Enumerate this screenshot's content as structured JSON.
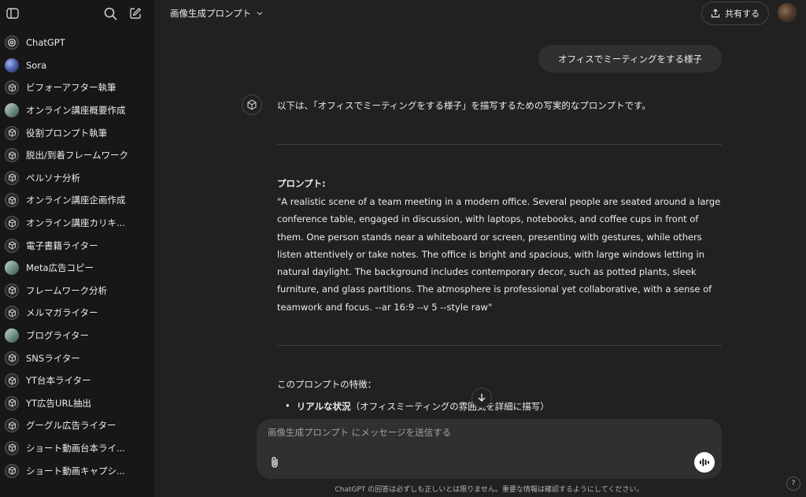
{
  "sidebar": {
    "items": [
      {
        "label": "ChatGPT",
        "icon": "chatgpt-logo-icon"
      },
      {
        "label": "Sora",
        "icon": "sora-avatar"
      },
      {
        "label": "ビフォーアフター執筆",
        "icon": "gpt-cube-icon"
      },
      {
        "label": "オンライン講座概要作成",
        "icon": "gpt-custom-avatar"
      },
      {
        "label": "役割プロンプト執筆",
        "icon": "gpt-cube-icon"
      },
      {
        "label": "脱出/到着フレームワーク",
        "icon": "gpt-cube-icon"
      },
      {
        "label": "ペルソナ分析",
        "icon": "gpt-cube-icon"
      },
      {
        "label": "オンライン講座企画作成",
        "icon": "gpt-cube-icon"
      },
      {
        "label": "オンライン講座カリキ...",
        "icon": "gpt-cube-icon"
      },
      {
        "label": "電子書籍ライター",
        "icon": "gpt-cube-icon"
      },
      {
        "label": "Meta広告コピー",
        "icon": "gpt-custom-avatar"
      },
      {
        "label": "フレームワーク分析",
        "icon": "gpt-cube-icon"
      },
      {
        "label": "メルマガライター",
        "icon": "gpt-cube-icon"
      },
      {
        "label": "ブログライター",
        "icon": "gpt-custom-avatar"
      },
      {
        "label": "SNSライター",
        "icon": "gpt-cube-icon"
      },
      {
        "label": "YT台本ライター",
        "icon": "gpt-cube-icon"
      },
      {
        "label": "YT広告URL抽出",
        "icon": "gpt-cube-icon"
      },
      {
        "label": "グーグル広告ライター",
        "icon": "gpt-cube-icon"
      },
      {
        "label": "ショート動画台本ライ...",
        "icon": "gpt-cube-icon"
      },
      {
        "label": "ショート動画キャプシ...",
        "icon": "gpt-cube-icon"
      }
    ]
  },
  "header": {
    "title": "画像生成プロンプト",
    "share_label": "共有する"
  },
  "chat": {
    "user_message": "オフィスでミーティングをする様子",
    "assistant": {
      "intro": "以下は、「オフィスでミーティングをする様子」を描写するための写実的なプロンプトです。",
      "prompt_heading": "プロンプト:",
      "prompt_lines": [
        "\"A realistic scene of a team meeting in a modern office. Several people are seated around a large",
        "conference table, engaged in discussion, with laptops, notebooks, and coffee cups in front of",
        "them. One person stands near a whiteboard or screen, presenting with gestures, while others",
        "listen attentively or take notes. The office is bright and spacious, with large windows letting in",
        "natural daylight. The background includes contemporary decor, such as potted plants, sleek",
        "furniture, and glass partitions. The atmosphere is professional yet collaborative, with a sense of",
        "teamwork and focus. --ar 16:9 --v 5 --style raw\""
      ],
      "features_heading": "このプロンプトの特徴：",
      "bullet_bold": "リアルな状況",
      "bullet_rest": "（オフィスミーティングの雰囲気を詳細に描写）"
    }
  },
  "composer": {
    "placeholder": "画像生成プロンプト にメッセージを送信する"
  },
  "footer": {
    "disclaimer": "ChatGPT の回答は必ずしも正しいとは限りません。重要な情報は確認するようにしてください。",
    "help": "?"
  },
  "colors": {
    "background": "#212121",
    "sidebar": "#171717",
    "bubble": "#303030"
  }
}
